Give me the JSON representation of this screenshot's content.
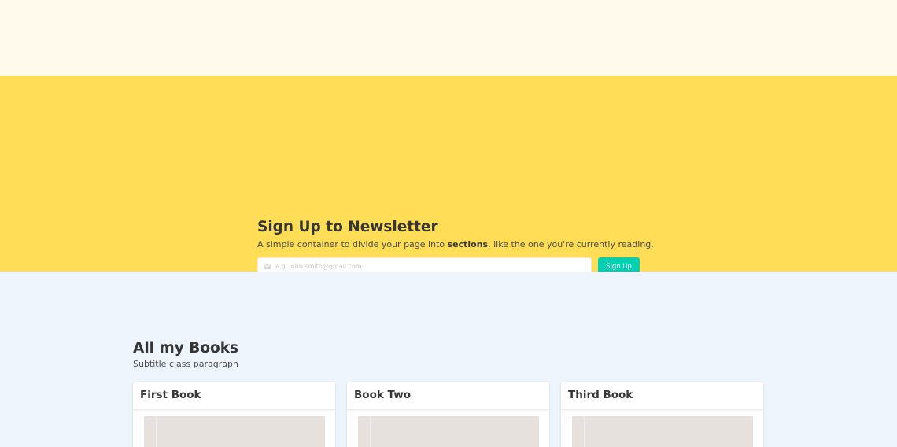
{
  "newsletter": {
    "title": "Sign Up to Newsletter",
    "subtitle_before": "A simple container to divide your page into ",
    "subtitle_bold": "sections",
    "subtitle_after": ", like the one you're currently reading.",
    "email_placeholder": "e.g. john.smith@gmail.com",
    "email_icon": "envelope-icon",
    "button_label": "Sign Up"
  },
  "books": {
    "title": "All my Books",
    "subtitle": "Subtitle class paragraph",
    "cards": [
      {
        "title": "First Book"
      },
      {
        "title": "Book Two"
      },
      {
        "title": "Third Book"
      }
    ]
  },
  "colors": {
    "top_band": "#fffaeb",
    "newsletter_bg": "#ffdd57",
    "books_bg": "#eef5fd",
    "button": "#00d1b2"
  }
}
